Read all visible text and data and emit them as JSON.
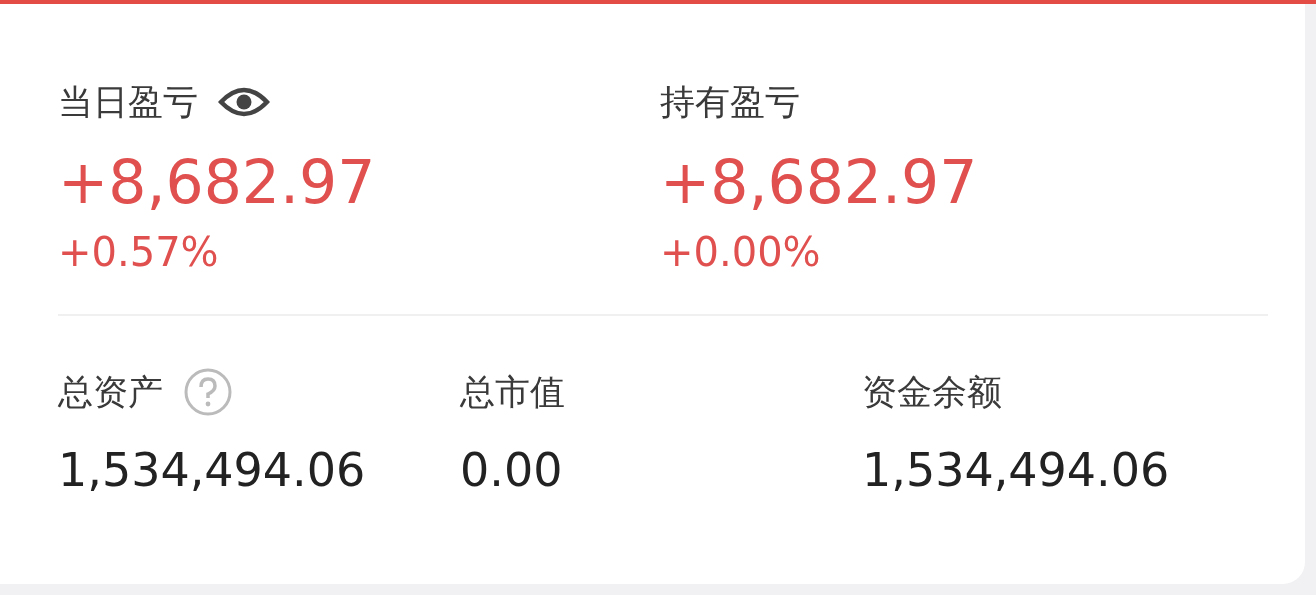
{
  "profit_panels": [
    {
      "label": "当日盈亏",
      "amount": "+8,682.97",
      "percent": "+0.57%"
    },
    {
      "label": "持有盈亏",
      "amount": "+8,682.97",
      "percent": "+0.00%"
    }
  ],
  "summary": [
    {
      "label": "总资产",
      "value": "1,534,494.06"
    },
    {
      "label": "总市值",
      "value": "0.00"
    },
    {
      "label": "资金余额",
      "value": "1,534,494.06"
    }
  ]
}
